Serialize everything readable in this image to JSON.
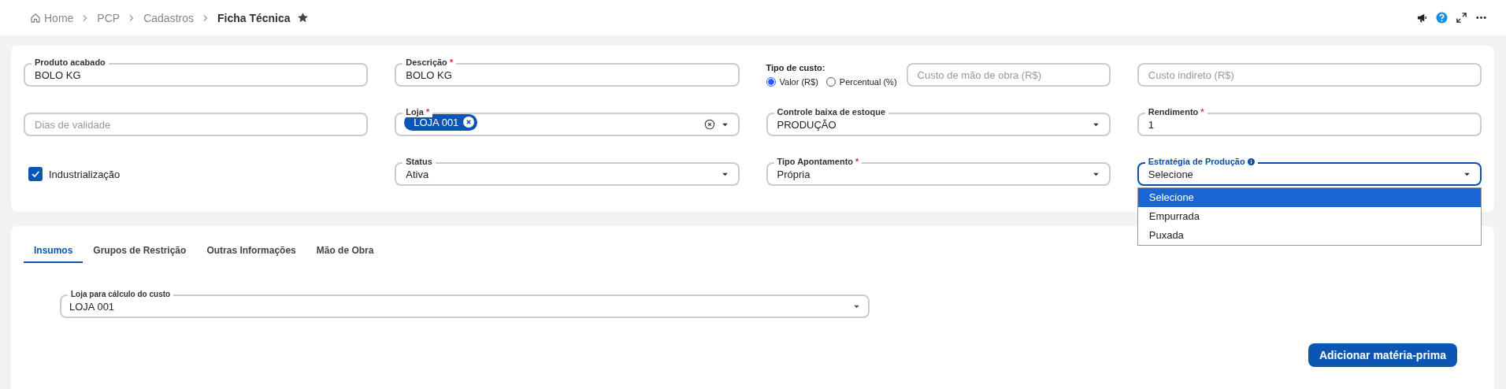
{
  "breadcrumb": [
    {
      "label": "Home",
      "kind": "home",
      "current": false
    },
    {
      "label": "PCP",
      "kind": "link",
      "current": false
    },
    {
      "label": "Cadastros",
      "kind": "link",
      "current": false
    },
    {
      "label": "Ficha Técnica",
      "kind": "link",
      "current": true
    }
  ],
  "favorite": true,
  "form_rows": [
    [
      {
        "kind": "text",
        "label": "Produto acabado",
        "value": "BOLO KG"
      },
      {
        "kind": "text",
        "label": "Descrição",
        "required_mark": "*",
        "value": "BOLO KG"
      },
      {
        "kind": "cost",
        "title": "Tipo de custo:",
        "options": [
          {
            "label": "Valor (R$)",
            "selected": true
          },
          {
            "label": "Percentual (%)",
            "selected": false
          }
        ],
        "field": {
          "placeholder": "Custo de mão de obra (R$)"
        }
      },
      {
        "kind": "text",
        "placeholder": "Custo indireto (R$)"
      }
    ],
    [
      {
        "kind": "text",
        "placeholder": "Dias de validade"
      },
      {
        "kind": "tags",
        "label": "Loja",
        "required_mark": "*",
        "tags": [
          "LOJA 001"
        ]
      },
      {
        "kind": "select",
        "label": "Controle baixa de estoque",
        "value": "PRODUÇÃO"
      },
      {
        "kind": "text",
        "label": "Rendimento",
        "required_mark": "*",
        "value": "1"
      }
    ],
    [
      {
        "kind": "checkbox",
        "label": "Industrialização",
        "checked": true
      },
      {
        "kind": "select",
        "label": "Status",
        "value": "Ativa"
      },
      {
        "kind": "select",
        "label": "Tipo Apontamento",
        "required_mark": "*",
        "value": "Própria"
      },
      {
        "kind": "select",
        "label": "Estratégia de Produção",
        "info": true,
        "expanded": true,
        "value": "Selecione",
        "options": [
          {
            "label": "Selecione",
            "selected": true
          },
          {
            "label": "Empurrada",
            "selected": false
          },
          {
            "label": "Puxada",
            "selected": false
          }
        ]
      }
    ]
  ],
  "tabs": [
    {
      "label": "Insumos",
      "selected": true
    },
    {
      "label": "Grupos de Restrição",
      "selected": false
    },
    {
      "label": "Outras Informações",
      "selected": false
    },
    {
      "label": "Mão de Obra",
      "selected": false
    }
  ],
  "cost_store": {
    "label": "Loja para cálculo do custo",
    "value": "LOJA 001"
  },
  "add_button": "Adicionar matéria-prima"
}
